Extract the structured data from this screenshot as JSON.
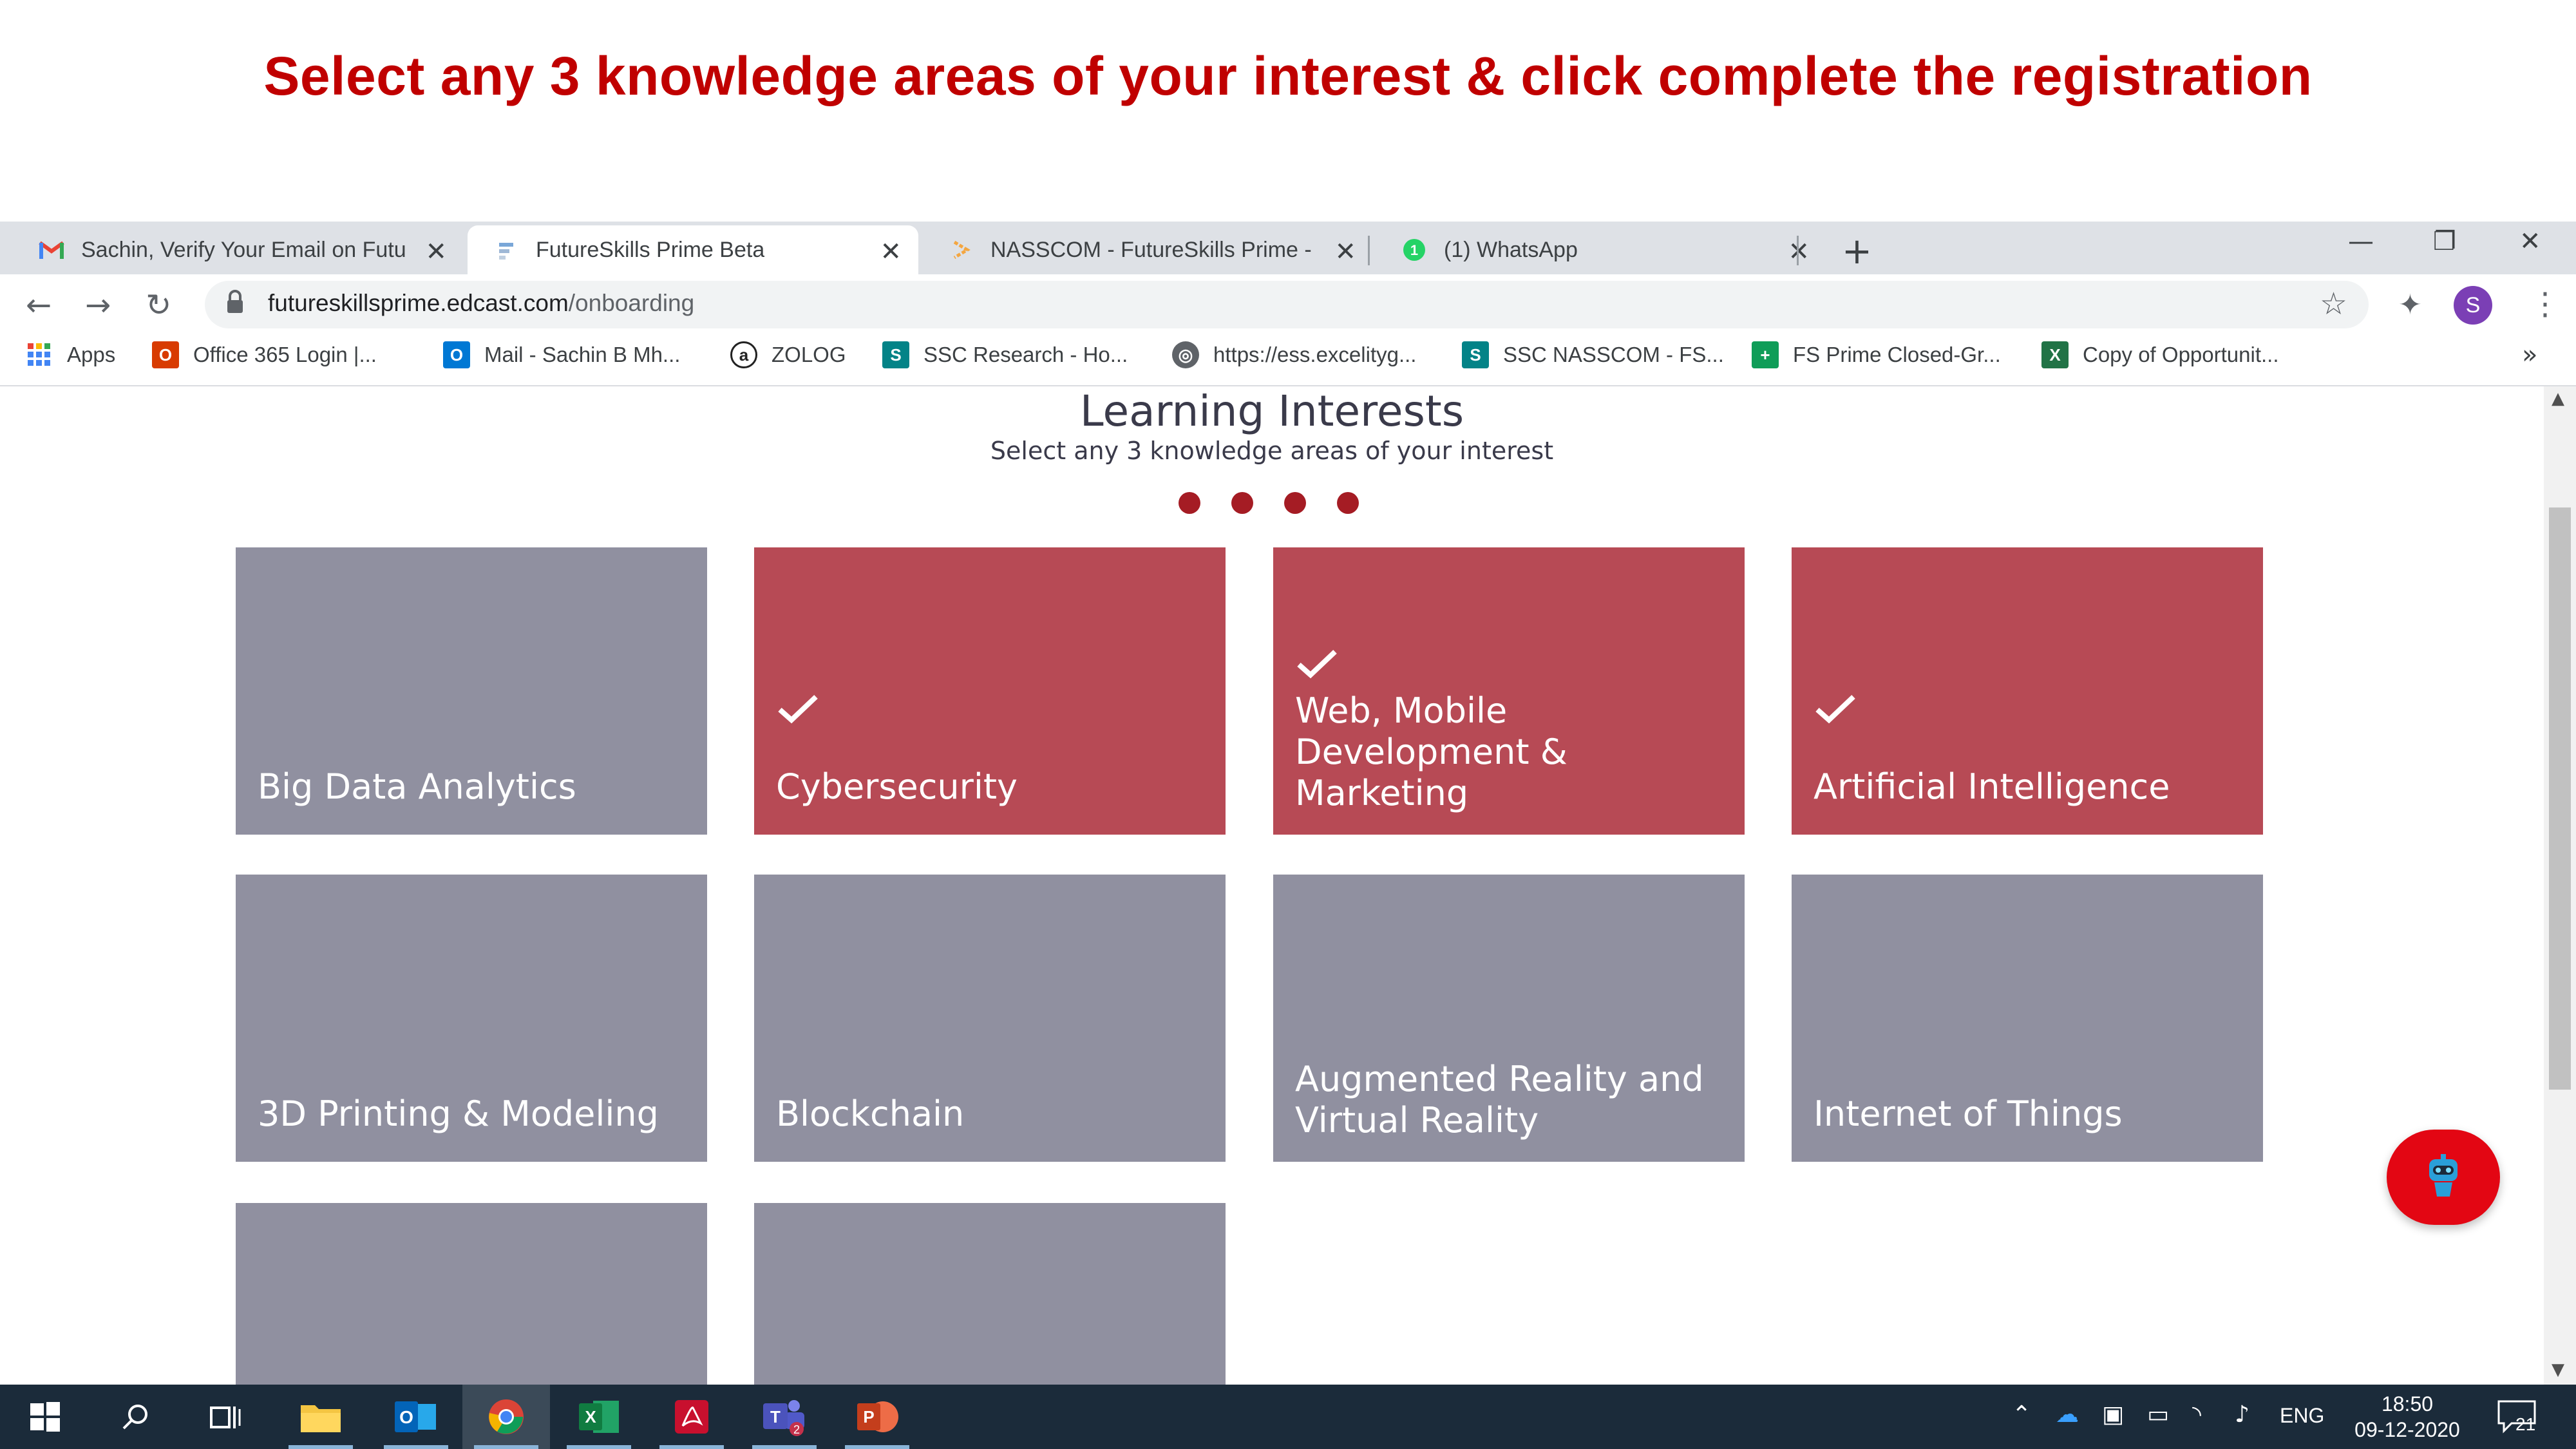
{
  "slide": {
    "title": "Select any 3 knowledge areas of your interest & click complete the registration"
  },
  "browser": {
    "tabs": [
      {
        "title": "Sachin, Verify Your Email on Futu",
        "icon": "gmail-icon",
        "active": false
      },
      {
        "title": "FutureSkills Prime Beta",
        "icon": "futureskills-icon",
        "active": true
      },
      {
        "title": "NASSCOM - FutureSkills Prime -",
        "icon": "nasscom-icon",
        "active": false
      },
      {
        "title": "(1) WhatsApp",
        "icon": "whatsapp-icon",
        "active": false
      }
    ],
    "new_tab": "+",
    "address": {
      "domain": "futureskillsprime.edcast.com",
      "path": "/onboarding"
    },
    "profile_initial": "S",
    "bookmarks": [
      {
        "label": "Apps",
        "icon": "apps-grid-icon"
      },
      {
        "label": "Office 365 Login |...",
        "icon": "office-icon"
      },
      {
        "label": "Mail - Sachin B Mh...",
        "icon": "outlook-icon"
      },
      {
        "label": "ZOLOG",
        "icon": "zolog-icon"
      },
      {
        "label": "SSC Research - Ho...",
        "icon": "sharepoint-icon"
      },
      {
        "label": "https://ess.excelityg...",
        "icon": "globe-icon"
      },
      {
        "label": "SSC NASSCOM - FS...",
        "icon": "sharepoint-icon"
      },
      {
        "label": "FS Prime Closed-Gr...",
        "icon": "sheets-icon"
      },
      {
        "label": "Copy of Opportunit...",
        "icon": "excel-icon"
      }
    ],
    "bookmarks_more": "»"
  },
  "page": {
    "heading": "Learning Interests",
    "subheading": "Select any 3 knowledge areas of your interest",
    "step_dots": 4,
    "cards": [
      {
        "label": "Big Data Analytics",
        "selected": false
      },
      {
        "label": "Cybersecurity",
        "selected": true
      },
      {
        "label": "Web, Mobile Development & Marketing",
        "selected": true
      },
      {
        "label": "Artificial Intelligence",
        "selected": true
      },
      {
        "label": "3D Printing & Modeling",
        "selected": false
      },
      {
        "label": "Blockchain",
        "selected": false
      },
      {
        "label": "Augmented Reality and Virtual Reality",
        "selected": false
      },
      {
        "label": "Internet of Things",
        "selected": false
      },
      {
        "label": "",
        "selected": false
      },
      {
        "label": "",
        "selected": false
      }
    ],
    "colors": {
      "selected": "#b74a55",
      "unselected": "#9090a0",
      "dot": "#a51c24",
      "title": "#c00000"
    }
  },
  "taskbar": {
    "apps": [
      "windows-start-icon",
      "search-icon",
      "task-view-icon",
      "file-explorer-icon",
      "outlook-icon",
      "chrome-icon",
      "excel-icon",
      "acrobat-icon",
      "teams-icon",
      "powerpoint-icon"
    ],
    "teams_badge": "2",
    "language": "ENG",
    "time": "18:50",
    "date": "09-12-2020",
    "notifications": "21"
  }
}
